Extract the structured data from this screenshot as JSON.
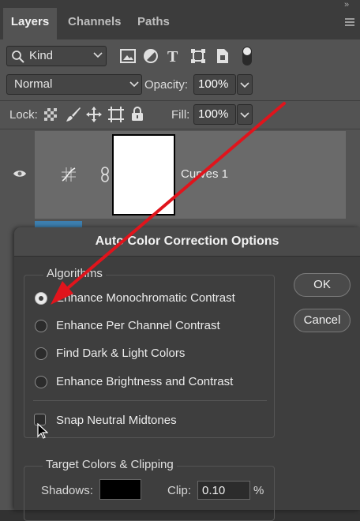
{
  "panel": {
    "tabs": [
      {
        "label": "Layers",
        "active": true
      },
      {
        "label": "Channels",
        "active": false
      },
      {
        "label": "Paths",
        "active": false
      }
    ],
    "collapse_glyph": "»",
    "filter": {
      "kind_label": "Kind",
      "icons": [
        "pixel-filter-icon",
        "adjustment-filter-icon",
        "type-filter-icon",
        "shape-filter-icon",
        "smart-object-filter-icon",
        "filter-toggle-icon"
      ]
    },
    "blend_mode": "Normal",
    "opacity": {
      "label": "Opacity:",
      "value": "100%"
    },
    "lock": {
      "label": "Lock:",
      "icons": [
        "lock-transparent-icon",
        "lock-image-icon",
        "lock-position-icon",
        "lock-artboard-icon",
        "lock-all-icon"
      ]
    },
    "fill": {
      "label": "Fill:",
      "value": "100%"
    },
    "layer": {
      "name": "Curves 1",
      "icons": [
        "eye-icon",
        "curves-adjustment-icon",
        "link-icon"
      ]
    }
  },
  "dialog": {
    "title": "Auto Color Correction Options",
    "algorithms_title": "Algorithms",
    "algorithms": [
      {
        "label": "Enhance Monochromatic Contrast",
        "selected": true
      },
      {
        "label": "Enhance Per Channel Contrast",
        "selected": false
      },
      {
        "label": "Find Dark & Light Colors",
        "selected": false
      },
      {
        "label": "Enhance Brightness and Contrast",
        "selected": false
      }
    ],
    "snap_label": "Snap Neutral Midtones",
    "snap_checked": false,
    "ok_label": "OK",
    "cancel_label": "Cancel",
    "target_title": "Target Colors & Clipping",
    "shadows_label": "Shadows:",
    "shadows_color": "#000000",
    "clip_label": "Clip:",
    "clip_value": "0.10",
    "clip_unit": "%"
  },
  "annotation": {
    "arrow_color": "#e0141c"
  }
}
